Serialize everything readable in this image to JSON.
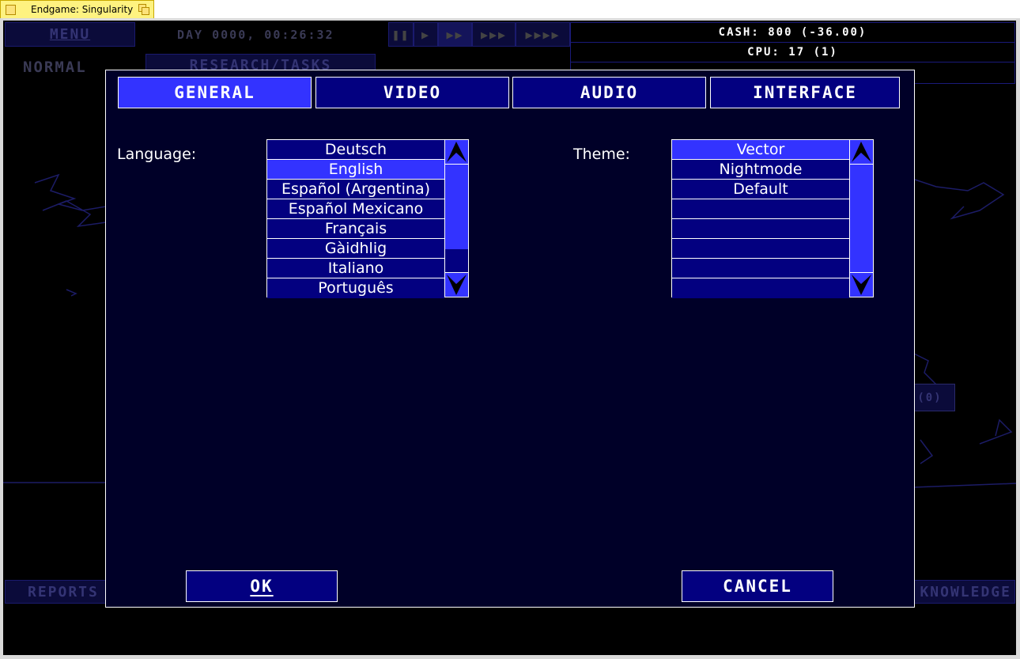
{
  "window": {
    "title": "Endgame: Singularity"
  },
  "topbar": {
    "menu_label": "MENU",
    "time": "DAY 0000, 00:26:32",
    "speeds": [
      "❚❚",
      "▶",
      "▶▶",
      "▶▶▶",
      "▶▶▶▶"
    ],
    "cash": "CASH: 800 (-36.00)",
    "cpu": "CPU: 17 (1)",
    "difficulty": "NORMAL",
    "research_label": "RESEARCH/TASKS"
  },
  "bottombar": {
    "reports_label": "REPORTS",
    "knowledge_label": "KNOWLEDGE",
    "partial_label": "(0)"
  },
  "dialog": {
    "tabs": [
      {
        "label": "GENERAL",
        "active": true
      },
      {
        "label": "VIDEO",
        "active": false
      },
      {
        "label": "AUDIO",
        "active": false
      },
      {
        "label": "INTERFACE",
        "active": false
      }
    ],
    "language_label": "Language:",
    "languages": [
      "Deutsch",
      "English",
      "Español (Argentina)",
      "Español Mexicano",
      "Français",
      "Gàidhlig",
      "Italiano",
      "Português"
    ],
    "language_selected": "English",
    "theme_label": "Theme:",
    "themes": [
      "Vector",
      "Nightmode",
      "Default",
      "",
      "",
      "",
      "",
      ""
    ],
    "theme_selected": "Vector",
    "ok_label": "OK",
    "cancel_label": "CANCEL"
  },
  "colors": {
    "dialog_bg": "#000028",
    "button_bg": "#030080",
    "active_bg": "#3333ff",
    "border": "#ffffff"
  }
}
